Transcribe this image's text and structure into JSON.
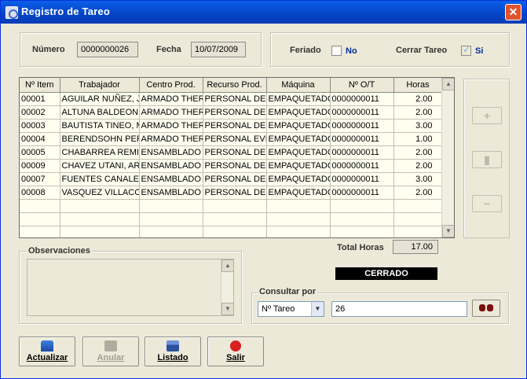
{
  "window": {
    "title": "Registro de Tareo",
    "close_glyph": "✕"
  },
  "header": {
    "numero_label": "Número",
    "numero_value": "0000000026",
    "fecha_label": "Fecha",
    "fecha_value": "10/07/2009",
    "feriado_label": "Feriado",
    "feriado_checked": false,
    "feriado_text": "No",
    "cerrar_label": "Cerrar Tareo",
    "cerrar_checked": true,
    "cerrar_text": "Si"
  },
  "grid": {
    "columns": [
      "Nº Item",
      "Trabajador",
      "Centro Prod.",
      "Recurso Prod.",
      "Máquina",
      "Nº O/T",
      "Horas"
    ],
    "rows": [
      [
        "00001",
        "AGUILAR NUÑEZ, JO",
        "ARMADO THERM",
        "PERSONAL DE P",
        "EMPAQUETADO",
        "0000000011",
        "2.00"
      ],
      [
        "00002",
        "ALTUNA BALDEON,",
        "ARMADO THERM",
        "PERSONAL DE P",
        "EMPAQUETADO",
        "0000000011",
        "2.00"
      ],
      [
        "00003",
        "BAUTISTA TINEO, M",
        "ARMADO THERM",
        "PERSONAL DE P",
        "EMPAQUETADO",
        "0000000011",
        "3.00"
      ],
      [
        "00004",
        "BERENDSOHN PERE",
        "ARMADO THERM",
        "PERSONAL EVE",
        "EMPAQUETADO",
        "0000000011",
        "1.00"
      ],
      [
        "00005",
        "CHABARREA REMIG",
        "ENSAMBLADO T",
        "PERSONAL DE P",
        "EMPAQUETADO",
        "0000000011",
        "2.00"
      ],
      [
        "00009",
        "CHAVEZ UTANI, AR",
        "ENSAMBLADO T",
        "PERSONAL DE P",
        "EMPAQUETADO",
        "0000000011",
        "2.00"
      ],
      [
        "00007",
        "FUENTES CANALES",
        "ENSAMBLADO T",
        "PERSONAL DE P",
        "EMPAQUETADO",
        "0000000011",
        "3.00"
      ],
      [
        "00008",
        "VASQUEZ VILLACO",
        "ENSAMBLADO T",
        "PERSONAL DE P",
        "EMPAQUETADO",
        "0000000011",
        "2.00"
      ]
    ]
  },
  "side_buttons": {
    "add": "+",
    "edit": "▮",
    "remove": "−"
  },
  "observaciones": {
    "label": "Observaciones",
    "value": ""
  },
  "totals": {
    "label": "Total Horas",
    "value": "17.00"
  },
  "status": {
    "text": "CERRADO",
    "color": "#000000"
  },
  "consultar": {
    "label": "Consultar por",
    "selected": "Nº Tareo",
    "value": "26"
  },
  "actions": {
    "actualizar": "Actualizar",
    "anular": "Anular",
    "listado": "Listado",
    "salir": "Salir"
  },
  "colors": {
    "titlebar": "#0a5fe8",
    "window_bg": "#ece9d8",
    "grid_bg": "#fffff0"
  }
}
